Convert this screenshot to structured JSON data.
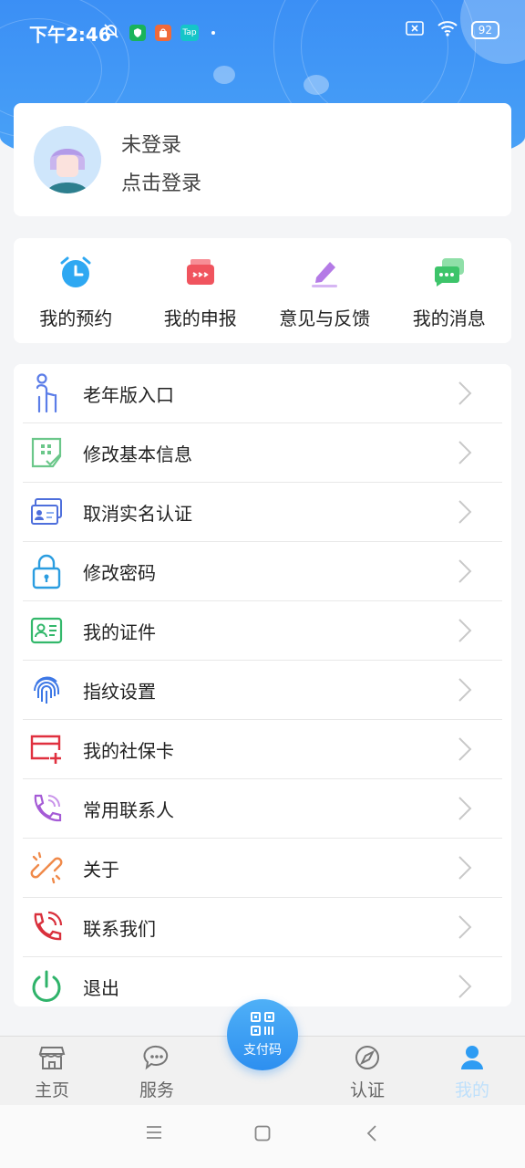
{
  "status_bar": {
    "time": "下午2:46",
    "battery": "92",
    "icons": [
      "mute-bell-icon",
      "shield-app-icon",
      "shopping-app-icon",
      "taptap-app-icon",
      "dot-icon",
      "close-box-icon",
      "wifi-icon",
      "battery-icon"
    ],
    "tap_label": "Tap"
  },
  "login": {
    "status": "未登录",
    "action": "点击登录"
  },
  "quick_actions": [
    {
      "label": "我的预约",
      "icon": "alarm-clock-icon",
      "color": "#2ea8f2"
    },
    {
      "label": "我的申报",
      "icon": "declare-icon",
      "color": "#f0545e"
    },
    {
      "label": "意见与反馈",
      "icon": "edit-pen-icon",
      "color": "#b47ae6"
    },
    {
      "label": "我的消息",
      "icon": "chat-icon",
      "color": "#3dc46a"
    }
  ],
  "menu": [
    {
      "label": "老年版入口",
      "icon": "elderly-icon"
    },
    {
      "label": "修改基本信息",
      "icon": "edit-info-icon"
    },
    {
      "label": "取消实名认证",
      "icon": "id-cards-icon"
    },
    {
      "label": "修改密码",
      "icon": "lock-icon"
    },
    {
      "label": "我的证件",
      "icon": "id-card-icon"
    },
    {
      "label": "指纹设置",
      "icon": "fingerprint-icon"
    },
    {
      "label": "我的社保卡",
      "icon": "social-card-icon"
    },
    {
      "label": "常用联系人",
      "icon": "phone-contact-icon"
    },
    {
      "label": "关于",
      "icon": "link-icon"
    },
    {
      "label": "联系我们",
      "icon": "phone-call-icon"
    },
    {
      "label": "退出",
      "icon": "power-icon"
    }
  ],
  "bottom_nav": {
    "home": "主页",
    "service": "服务",
    "pay_code": "支付码",
    "auth": "认证",
    "mine": "我的"
  },
  "colors": {
    "primary": "#3b8ff5",
    "active_tab": "#bfe0fb"
  }
}
